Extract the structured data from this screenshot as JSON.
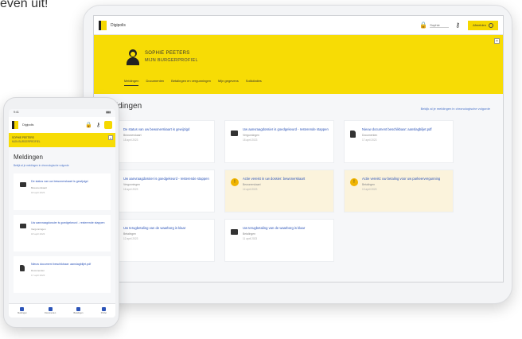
{
  "caption": "even uit!",
  "tablet": {
    "topbar": {
      "title": "Digipolis",
      "user": "Sophie",
      "signout": "Afmelden"
    },
    "banner": {
      "name": "SOPHIE PEETERS",
      "subtitle": "MIJN BURGERPROFIEL",
      "close": "×",
      "tabs": [
        "Meldingen",
        "Documenten",
        "Betalingen en vergunningen",
        "Mijn gegevens",
        "Sollicitaties"
      ],
      "active_tab": "Meldingen"
    },
    "main": {
      "heading": "Meldingen",
      "link_all": "Bekijk al je meldingen in chronologische volgorde",
      "cards": [
        {
          "title": "De status van uw bewonerskaart is gewijzigd",
          "meta": "Bewonerskaart",
          "date": "18 april 2023",
          "icon": "car-icon",
          "warn": false
        },
        {
          "title": "Uw aanvraagdossier is goedgekeurd - resterende stappen",
          "meta": "Vergunningen",
          "date": "18 april 2023",
          "icon": "car-icon",
          "warn": false
        },
        {
          "title": "Nieuw document beschikbaar: aanslagbiljet.pdf",
          "meta": "Documenten",
          "date": "17 april 2023",
          "icon": "doc-icon",
          "warn": false
        },
        {
          "title": "Uw aanvraagdossier is goedgekeurd - resterende stappen",
          "meta": "Vergunningen",
          "date": "16 april 2023",
          "icon": "car-icon",
          "warn": false
        },
        {
          "title": "Actie vereist in uw dossier: bewonerskaart",
          "meta": "Bewonerskaart",
          "date": "14 april 2023",
          "icon": "warning-icon",
          "warn": true
        },
        {
          "title": "Actie vereist: uw betaling voor uw parkeervergunning",
          "meta": "Betalingen",
          "date": "13 april 2023",
          "icon": "warning-icon",
          "warn": true
        },
        {
          "title": "Uw terugbetaling van de waarborg is klaar",
          "meta": "Betalingen",
          "date": "12 april 2023",
          "icon": "car-icon",
          "warn": false
        },
        {
          "title": "Uw terugbetaling van de waarborg is klaar",
          "meta": "Betalingen",
          "date": "11 april 2023",
          "icon": "car-icon",
          "warn": false
        }
      ]
    }
  },
  "phone": {
    "status": {
      "time": "9:41",
      "signal": "▮▮▮"
    },
    "topbar": {
      "title": "Digipolis"
    },
    "banner": {
      "line1": "SOPHIE PEETERS",
      "line2": "MIJN BURGERPROFIEL",
      "close": "×"
    },
    "main": {
      "heading": "Meldingen",
      "link_all": "Bekijk al je meldingen in chronologische volgorde",
      "cards": [
        {
          "title": "De status van uw bewonerskaart is gewijzigd",
          "meta": "Bewonerskaart",
          "date": "18 april 2023",
          "icon": "car-icon"
        },
        {
          "title": "Uw aanvraagdossier is goedgekeurd - resterende stappen",
          "meta": "Vergunningen",
          "date": "18 april 2023",
          "icon": "car-icon"
        },
        {
          "title": "Nieuw document beschikbaar: aanslagbiljet.pdf",
          "meta": "Documenten",
          "date": "17 april 2023",
          "icon": "doc-icon"
        }
      ]
    },
    "nav": [
      "Meldingen",
      "Documenten",
      "Betalingen",
      "Profiel"
    ]
  },
  "colors": {
    "brand_yellow": "#f7dc05",
    "link_blue": "#2c54b8",
    "warn_bg": "#fbf3dc",
    "warn_icon": "#f0b400"
  }
}
